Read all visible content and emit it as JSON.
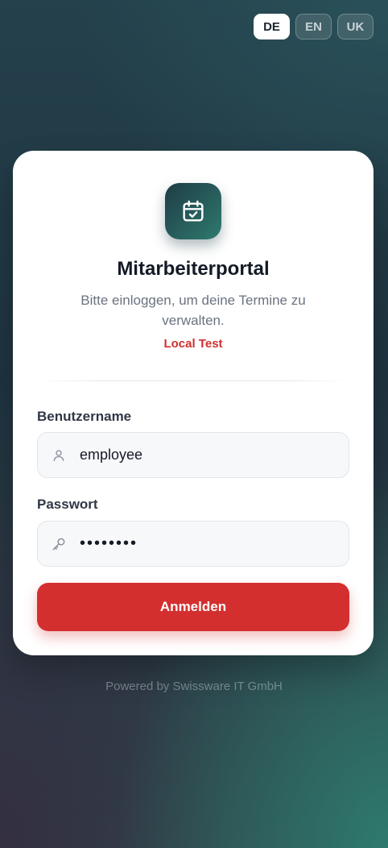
{
  "languages": [
    {
      "code": "DE",
      "active": true
    },
    {
      "code": "EN",
      "active": false
    },
    {
      "code": "UK",
      "active": false
    }
  ],
  "login": {
    "logo_icon": "calendar-check-icon",
    "title": "Mitarbeiterportal",
    "subtitle": "Bitte einloggen, um deine Termine zu verwalten.",
    "environment": "Local Test",
    "username": {
      "label": "Benutzername",
      "value": "employee",
      "icon": "user-icon"
    },
    "password": {
      "label": "Passwort",
      "value": "password",
      "icon": "key-icon"
    },
    "submit_label": "Anmelden"
  },
  "footer": "Powered by Swissware IT GmbH",
  "colors": {
    "accent": "#d42f2f",
    "brand_dark": "#1f3c46",
    "brand_teal": "#2e7a6e"
  }
}
